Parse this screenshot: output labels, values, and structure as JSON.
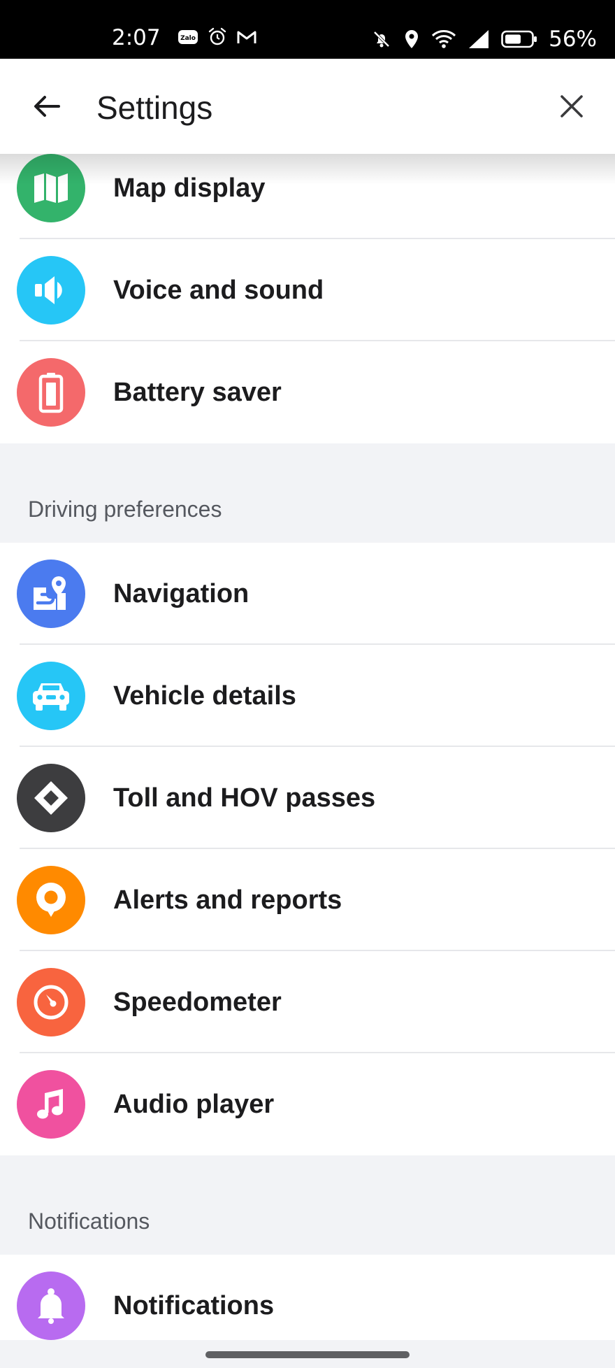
{
  "status_bar": {
    "time": "2:07",
    "battery_percent": "56%",
    "left_icons": [
      "zalo-icon",
      "alarm-icon",
      "gmail-icon"
    ],
    "right_icons": [
      "mute-icon",
      "location-icon",
      "wifi-icon",
      "signal-icon",
      "battery-icon"
    ]
  },
  "header": {
    "title": "Settings",
    "back_icon": "back-arrow-icon",
    "close_icon": "close-icon"
  },
  "groups": [
    {
      "title": "",
      "items": [
        {
          "label": "Map display",
          "icon": "map-icon",
          "color": "#33b36b"
        },
        {
          "label": "Voice and sound",
          "icon": "speaker-icon",
          "color": "#26c6f6"
        },
        {
          "label": "Battery saver",
          "icon": "battery-icon",
          "color": "#f4696b"
        }
      ]
    },
    {
      "title": "Driving preferences",
      "items": [
        {
          "label": "Navigation",
          "icon": "navigation-icon",
          "color": "#4b7bef"
        },
        {
          "label": "Vehicle details",
          "icon": "car-icon",
          "color": "#26c6f6"
        },
        {
          "label": "Toll and HOV passes",
          "icon": "diamond-icon",
          "color": "#3d3d3f"
        },
        {
          "label": "Alerts and reports",
          "icon": "alert-pin-icon",
          "color": "#ff8a00"
        },
        {
          "label": "Speedometer",
          "icon": "speedometer-icon",
          "color": "#f8643f"
        },
        {
          "label": "Audio player",
          "icon": "music-note-icon",
          "color": "#f0519f"
        }
      ]
    },
    {
      "title": "Notifications",
      "items": [
        {
          "label": "Notifications",
          "icon": "bell-icon",
          "color": "#b86bf0"
        }
      ]
    }
  ]
}
